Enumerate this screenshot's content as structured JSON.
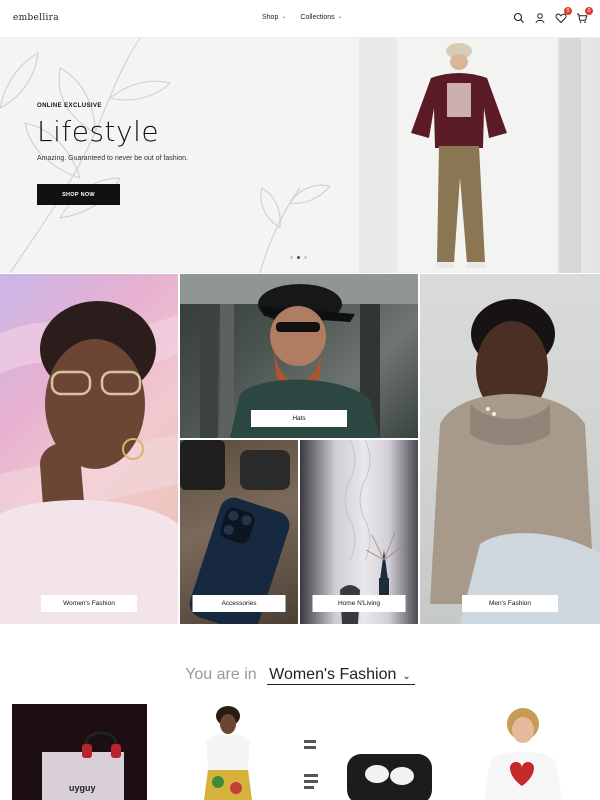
{
  "header": {
    "logo": "embellira",
    "nav": [
      {
        "label": "Shop",
        "chevron": "chevron-down-icon"
      },
      {
        "label": "Collections",
        "chevron": "chevron-down-icon"
      }
    ],
    "icons": [
      "search-icon",
      "user-icon",
      "heart-icon",
      "cart-icon"
    ],
    "wishlist_count": "0",
    "cart_count": "0",
    "badge_color": "#e03b2c"
  },
  "hero": {
    "eyebrow": "ONLINE EXCLUSIVE",
    "title": "Lifestyle",
    "subtitle": "Amazing. Guaranteed to never be out of fashion.",
    "button": "SHOP NOW",
    "slides_total": 3,
    "active_slide": 2
  },
  "collage": {
    "women": "Women's Fashion",
    "hats": "Hats",
    "accessories": "Accessories",
    "home": "Home N'Living",
    "men": "Men's Fashion"
  },
  "you_are_in": {
    "prefix": "You are in",
    "selected": "Women's Fashion"
  },
  "products": {
    "p1_text": "uyguy"
  }
}
